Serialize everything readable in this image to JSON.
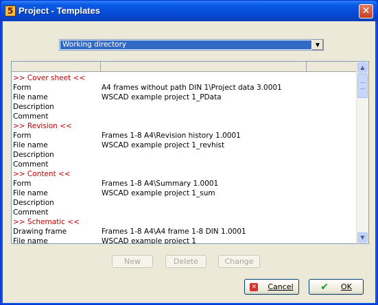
{
  "window": {
    "title": "Project - Templates",
    "close_label": "✕",
    "icon_glyph": "5"
  },
  "source_select": {
    "value": "Working directory",
    "arrow": "▼"
  },
  "list": {
    "rows": [
      {
        "label": ">> Cover sheet <<",
        "value": "",
        "section": true
      },
      {
        "label": "Form",
        "value": "A4 frames without path DIN 1\\Project data 3.0001",
        "section": false
      },
      {
        "label": "File name",
        "value": "WSCAD example project 1_PData",
        "section": false
      },
      {
        "label": "Description",
        "value": "",
        "section": false
      },
      {
        "label": "Comment",
        "value": "",
        "section": false
      },
      {
        "label": ">> Revision <<",
        "value": "",
        "section": true
      },
      {
        "label": "Form",
        "value": "Frames 1-8 A4\\Revision history 1.0001",
        "section": false
      },
      {
        "label": "File name",
        "value": "WSCAD example project 1_revhist",
        "section": false
      },
      {
        "label": "Description",
        "value": "",
        "section": false
      },
      {
        "label": "Comment",
        "value": "",
        "section": false
      },
      {
        "label": ">> Content <<",
        "value": "",
        "section": true
      },
      {
        "label": "Form",
        "value": "Frames 1-8 A4\\Summary 1.0001",
        "section": false
      },
      {
        "label": "File name",
        "value": "WSCAD example project 1_sum",
        "section": false
      },
      {
        "label": "Description",
        "value": "",
        "section": false
      },
      {
        "label": "Comment",
        "value": "",
        "section": false
      },
      {
        "label": ">> Schematic <<",
        "value": "",
        "section": true
      },
      {
        "label": "Drawing frame",
        "value": "Frames 1-8 A4\\A4 frame 1-8 DIN 1.0001",
        "section": false
      },
      {
        "label": "File name",
        "value": "WSCAD example project 1",
        "section": false
      }
    ]
  },
  "scrollbar": {
    "up": "▲",
    "down": "▼"
  },
  "buttons": {
    "new": "New",
    "delete": "Delete",
    "change": "Change",
    "cancel": "Cancel",
    "ok": "OK"
  },
  "colors": {
    "section_text": "#c00000",
    "selection": "#316ac5",
    "title_bar": "#0a5ae6"
  }
}
